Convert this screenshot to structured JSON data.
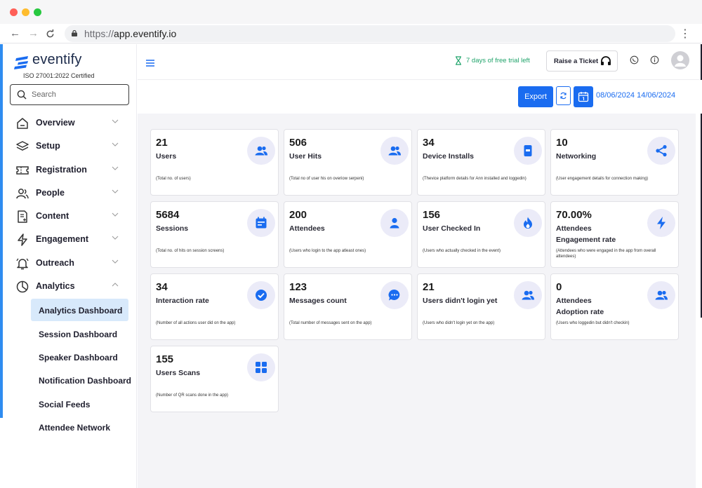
{
  "browser": {
    "url_scheme": "https://",
    "url_host": "app.eventify.io"
  },
  "brand": {
    "name": "eventify",
    "certification": "ISO 27001:2022 Certified",
    "accent": "#1a6cf0"
  },
  "search": {
    "placeholder": "Search"
  },
  "sidebar": {
    "items": [
      {
        "label": "Overview",
        "icon": "home-icon"
      },
      {
        "label": "Setup",
        "icon": "layers-icon"
      },
      {
        "label": "Registration",
        "icon": "ticket-icon"
      },
      {
        "label": "People",
        "icon": "people-icon"
      },
      {
        "label": "Content",
        "icon": "document-add-icon"
      },
      {
        "label": "Engagement",
        "icon": "lightning-icon"
      },
      {
        "label": "Outreach",
        "icon": "bell-icon"
      },
      {
        "label": "Analytics",
        "icon": "pie-chart-icon"
      }
    ],
    "analytics_sub": [
      {
        "label": "Analytics Dashboard"
      },
      {
        "label": "Session Dashboard"
      },
      {
        "label": "Speaker Dashboard"
      },
      {
        "label": "Notification Dashboard"
      },
      {
        "label": "Social Feeds"
      },
      {
        "label": "Attendee Network"
      }
    ]
  },
  "topbar": {
    "trial_text": "7 days of free trial left",
    "ticket_label": "Raise a Ticket"
  },
  "actions": {
    "export_label": "Export",
    "date_range": "08/06/2024  14/06/2024"
  },
  "cards": [
    {
      "value": "21",
      "title": "Users",
      "desc": "(Total no. of users)",
      "icon": "users-icon"
    },
    {
      "value": "506",
      "title": "User Hits",
      "desc": "(Total no of user his on overiow serpeni)",
      "icon": "users-icon"
    },
    {
      "value": "34",
      "title": "Device Installs",
      "desc": "(Thevice platform details for Ann installed and loggedin)",
      "icon": "device-icon"
    },
    {
      "value": "10",
      "title": "Networking",
      "desc": "(User engagement details for connection making)",
      "icon": "share-icon"
    },
    {
      "value": "5684",
      "title": "Sessions",
      "desc": "(Total no. of hits on session screens)",
      "icon": "calendar-icon"
    },
    {
      "value": "200",
      "title": "Attendees",
      "desc": "(Users who login to the app atleast ones)",
      "icon": "person-icon"
    },
    {
      "value": "156",
      "title": "User Checked In",
      "desc": "(Users who actually checked in the event)",
      "icon": "flame-icon"
    },
    {
      "value": "70.00%",
      "title": "Attendees\nEngagement rate",
      "desc": "(Attendees who were engaged in the app from overall attendees)",
      "icon": "bolt-icon"
    },
    {
      "value": "34",
      "title": "Interaction rate",
      "desc": "(Number of all actions user did on the app)",
      "icon": "check-circle-icon"
    },
    {
      "value": "123",
      "title": "Messages count",
      "desc": "(Total number of messages sent on the app)",
      "icon": "chat-icon"
    },
    {
      "value": "21",
      "title": "Users didn't login yet",
      "desc": "(Users who didn't login yet on the app)",
      "icon": "users-icon"
    },
    {
      "value": "0",
      "title": "Attendees\nAdoption rate",
      "desc": "(Users who loggedin but didn't checkin)",
      "icon": "users-icon"
    },
    {
      "value": "155",
      "title": "Users Scans",
      "desc": "(Number of QR scans done in the app)",
      "icon": "grid-icon"
    }
  ]
}
